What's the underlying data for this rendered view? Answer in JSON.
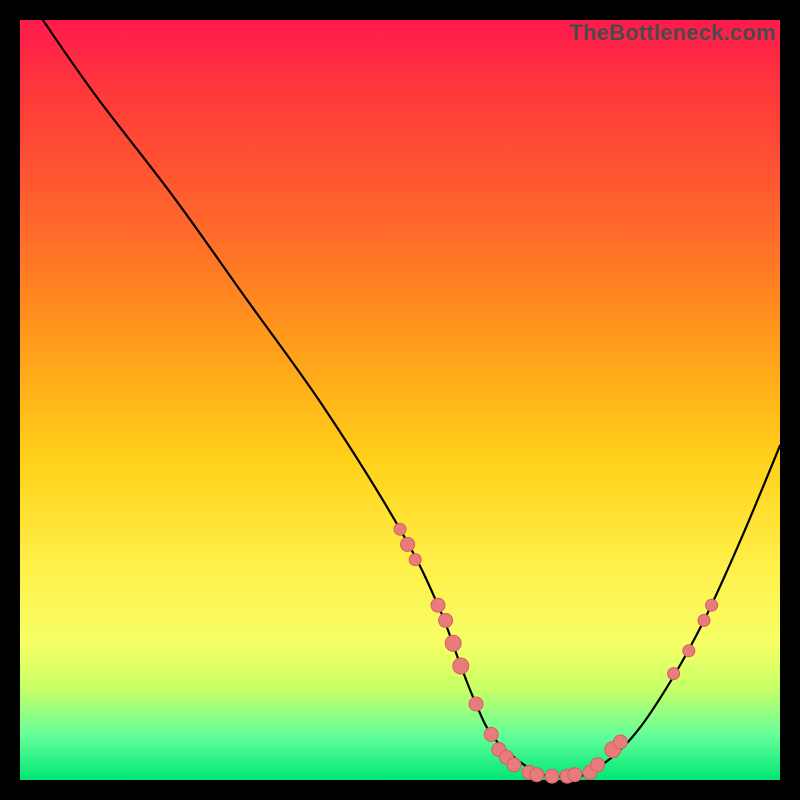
{
  "watermark": "TheBottleneck.com",
  "colors": {
    "dot_fill": "#e87b7b",
    "dot_stroke": "#d46060",
    "curve": "#000000",
    "gradient_top": "#ff1a4d",
    "gradient_bottom": "#00e676"
  },
  "chart_data": {
    "type": "line",
    "title": "",
    "xlabel": "",
    "ylabel": "",
    "xlim": [
      0,
      100
    ],
    "ylim": [
      0,
      100
    ],
    "grid": false,
    "legend": false,
    "series": [
      {
        "name": "curve",
        "x": [
          3,
          10,
          20,
          30,
          40,
          50,
          55,
          58,
          60,
          62,
          65,
          68,
          70,
          72,
          75,
          80,
          85,
          90,
          95,
          100
        ],
        "y": [
          100,
          90,
          77,
          63,
          49,
          33,
          23,
          15,
          10,
          6,
          3,
          1,
          0.5,
          0.5,
          1,
          5,
          12,
          21,
          32,
          44
        ]
      }
    ],
    "markers": [
      {
        "x": 50,
        "y": 33,
        "r": 6
      },
      {
        "x": 51,
        "y": 31,
        "r": 7
      },
      {
        "x": 52,
        "y": 29,
        "r": 6
      },
      {
        "x": 55,
        "y": 23,
        "r": 7
      },
      {
        "x": 56,
        "y": 21,
        "r": 7
      },
      {
        "x": 57,
        "y": 18,
        "r": 8
      },
      {
        "x": 58,
        "y": 15,
        "r": 8
      },
      {
        "x": 60,
        "y": 10,
        "r": 7
      },
      {
        "x": 62,
        "y": 6,
        "r": 7
      },
      {
        "x": 63,
        "y": 4,
        "r": 7
      },
      {
        "x": 64,
        "y": 3,
        "r": 7
      },
      {
        "x": 65,
        "y": 2,
        "r": 7
      },
      {
        "x": 67,
        "y": 1,
        "r": 7
      },
      {
        "x": 68,
        "y": 0.7,
        "r": 7
      },
      {
        "x": 70,
        "y": 0.5,
        "r": 7
      },
      {
        "x": 72,
        "y": 0.5,
        "r": 7
      },
      {
        "x": 73,
        "y": 0.7,
        "r": 7
      },
      {
        "x": 75,
        "y": 1,
        "r": 7
      },
      {
        "x": 76,
        "y": 2,
        "r": 7
      },
      {
        "x": 78,
        "y": 4,
        "r": 8
      },
      {
        "x": 79,
        "y": 5,
        "r": 7
      },
      {
        "x": 86,
        "y": 14,
        "r": 6
      },
      {
        "x": 88,
        "y": 17,
        "r": 6
      },
      {
        "x": 90,
        "y": 21,
        "r": 6
      },
      {
        "x": 91,
        "y": 23,
        "r": 6
      }
    ]
  }
}
